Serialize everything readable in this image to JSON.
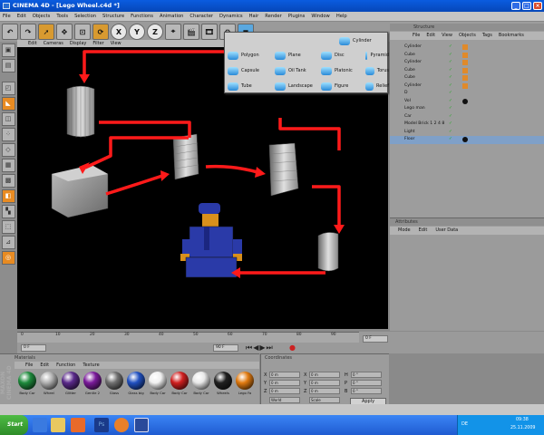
{
  "window": {
    "title": "CINEMA 4D - [Lego Wheel.c4d *]",
    "buttons": [
      "_",
      "□",
      "×"
    ]
  },
  "menubar": [
    "File",
    "Edit",
    "Objects",
    "Tools",
    "Selection",
    "Structure",
    "Functions",
    "Animation",
    "Character",
    "Dynamics",
    "Hair",
    "Render",
    "Plugins",
    "Window",
    "Help"
  ],
  "toolbar": {
    "axes": [
      "X",
      "Y",
      "Z"
    ]
  },
  "viewport_menu": [
    "Edit",
    "Cameras",
    "Display",
    "Filter",
    "View"
  ],
  "popup": {
    "items": [
      "Cylinder",
      "Polygon",
      "Plane",
      "Disc",
      "Pyramid",
      "Capsule",
      "Oil Tank",
      "Platonic",
      "Torus",
      "Tube",
      "Landscape",
      "Figure",
      "Relief"
    ]
  },
  "object_manager": {
    "title": "Structure",
    "menu": [
      "File",
      "Edit",
      "View",
      "Objects",
      "Tags",
      "Bookmarks"
    ],
    "rows": [
      "Cylinder",
      "Cube",
      "Cylinder",
      "Cube",
      "Cube",
      "Cylinder",
      "D",
      "Vol",
      "Lego man",
      "Car",
      "Model Brick 1 2 4 8",
      "Light",
      "Floor"
    ]
  },
  "attributes": {
    "title": "Attributes",
    "menu": [
      "Mode",
      "Edit",
      "User Data"
    ]
  },
  "timeline": {
    "ticks": [
      "0",
      "10",
      "20",
      "30",
      "40",
      "50",
      "60",
      "70",
      "80",
      "90"
    ],
    "start": "0 F",
    "end": "90 F",
    "current": "0 F"
  },
  "materials": {
    "title": "Materials",
    "menu": [
      "File",
      "Edit",
      "Function",
      "Texture"
    ],
    "items": [
      {
        "name": "Body Car",
        "color": "#1e8a3c"
      },
      {
        "name": "Wheel",
        "color": "#b0b0b0"
      },
      {
        "name": "Glitter",
        "color": "#5a2a8a"
      },
      {
        "name": "Gentle 2",
        "color": "#7a1a9a"
      },
      {
        "name": "Glass",
        "color": "#707070"
      },
      {
        "name": "Glass big",
        "color": "#2050c0"
      },
      {
        "name": "Body Car",
        "color": "#f0f0f0"
      },
      {
        "name": "Body Car",
        "color": "#d02020"
      },
      {
        "name": "Body Car",
        "color": "#e8e8e8"
      },
      {
        "name": "Wheels",
        "color": "#202020"
      },
      {
        "name": "Lego Fa",
        "color": "#e07a10"
      }
    ]
  },
  "coordinates": {
    "title": "Coordinates",
    "rows": [
      {
        "a": "X",
        "av": "0 m",
        "b": "X",
        "bv": "0 m",
        "c": "H",
        "cv": "0 °"
      },
      {
        "a": "Y",
        "av": "0 m",
        "b": "Y",
        "bv": "0 m",
        "c": "P",
        "cv": "0 °"
      },
      {
        "a": "Z",
        "av": "0 m",
        "b": "Z",
        "bv": "0 m",
        "c": "B",
        "cv": "0 °"
      }
    ],
    "mode1": "World",
    "mode2": "Scale",
    "apply": "Apply"
  },
  "side_logo": "MAXON CINEMA 4D",
  "taskbar": {
    "start": "Start",
    "clock": "09:38",
    "date": "25.11.2009",
    "lang": "DE"
  }
}
